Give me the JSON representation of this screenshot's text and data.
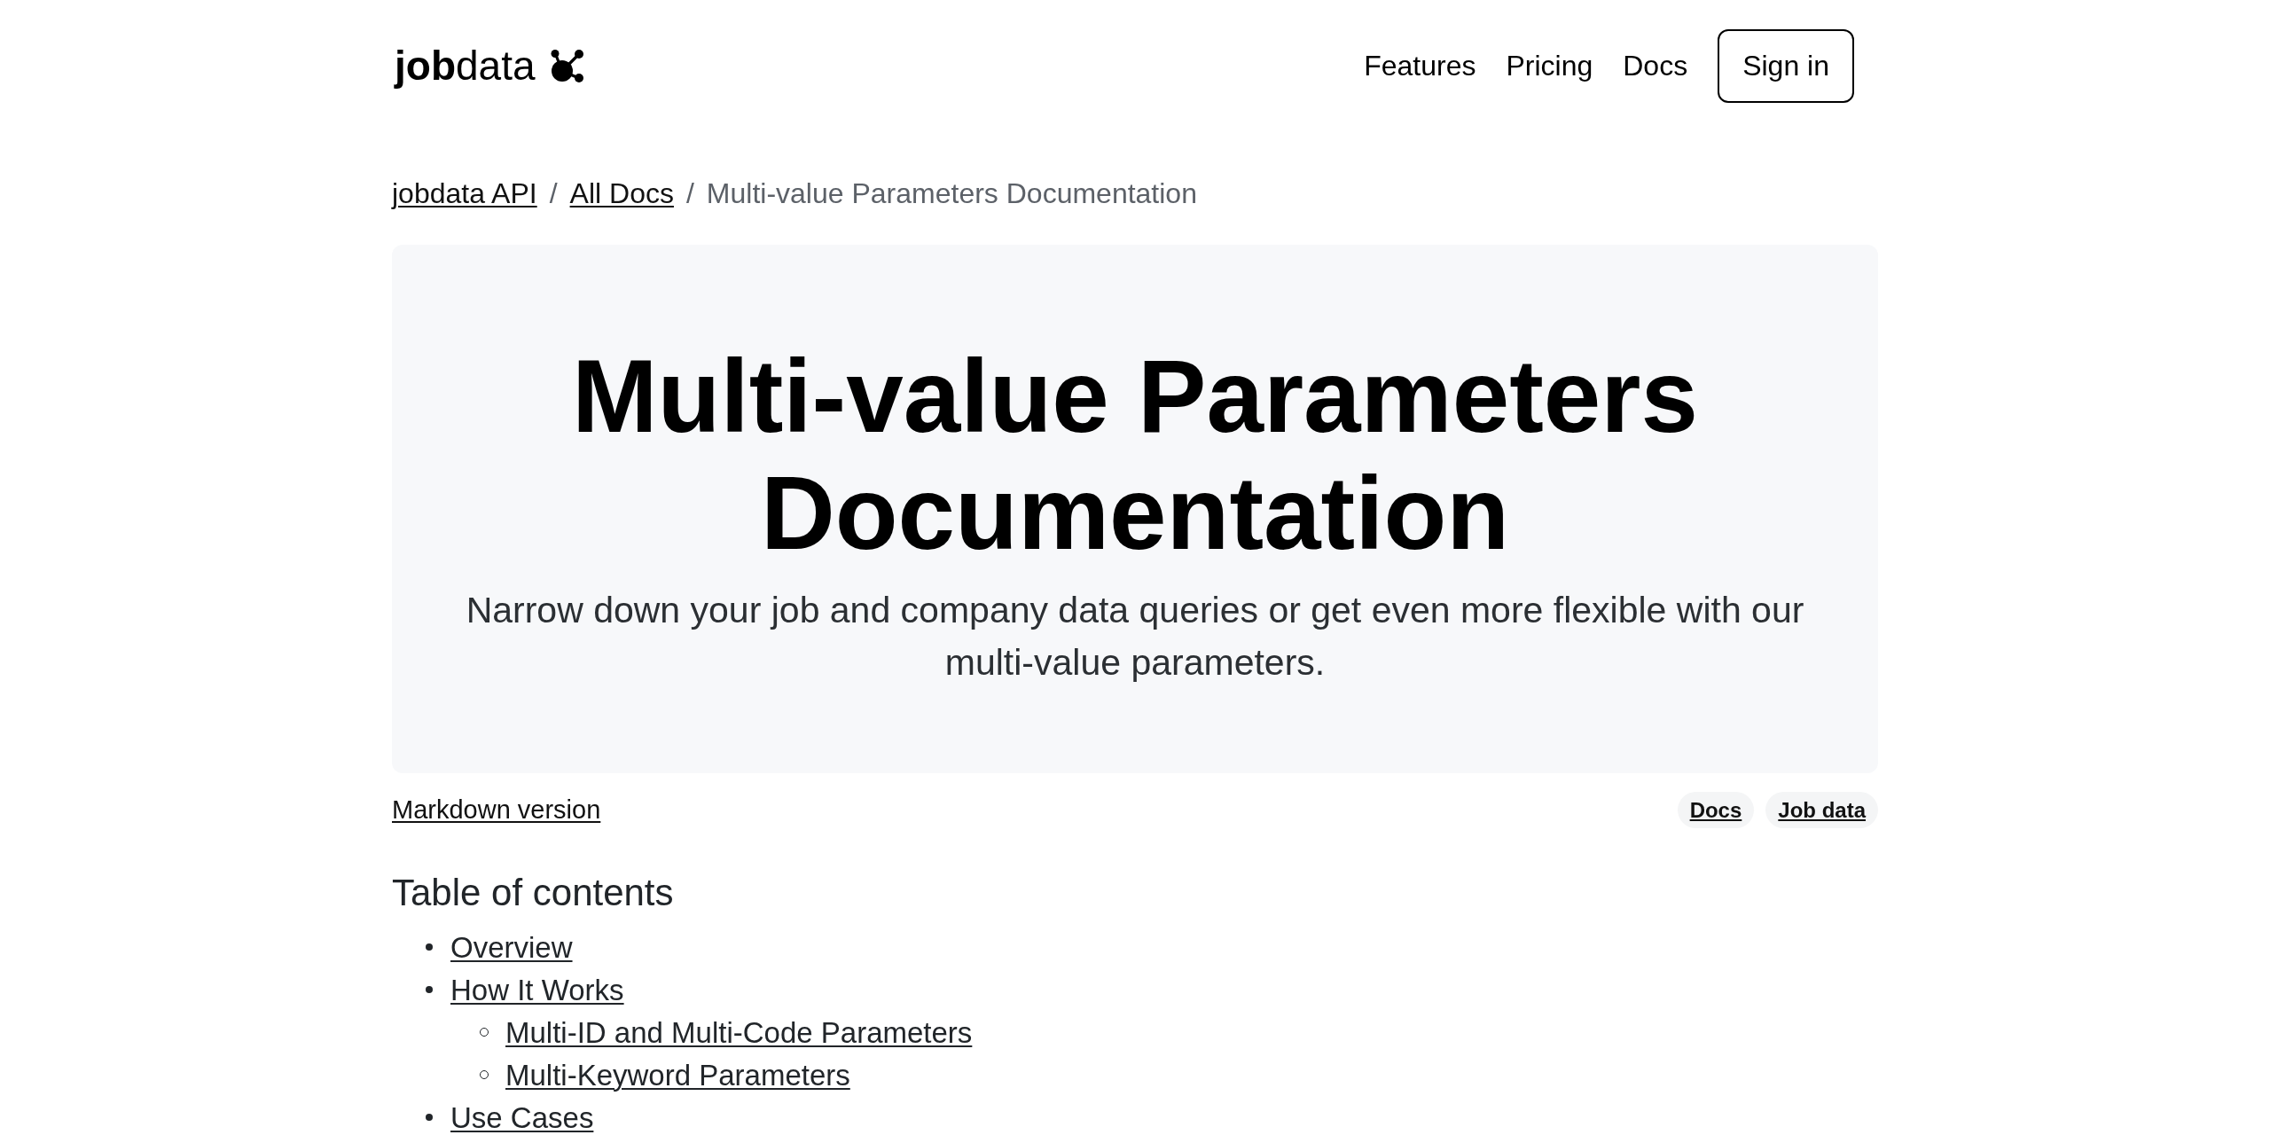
{
  "header": {
    "logo": "**job**data",
    "nav": [
      {
        "label": "Features"
      },
      {
        "label": "Pricing"
      },
      {
        "label": "Docs"
      }
    ],
    "sign_in": "Sign in"
  },
  "breadcrumb": {
    "items": [
      {
        "label": "jobdata API",
        "kind": "link"
      },
      {
        "label": "All Docs",
        "kind": "link"
      },
      {
        "label": "Multi-value Parameters Documentation",
        "kind": "current"
      }
    ],
    "separators": [
      "/",
      "/"
    ]
  },
  "hero": {
    "title": "Multi-value Parameters Documentation",
    "subtitle": "Narrow down your job and company data queries or get even more flexible with our multi-value parameters."
  },
  "meta": {
    "markdown_link": "Markdown version",
    "tags": [
      {
        "label": "Docs"
      },
      {
        "label": "Job data"
      }
    ]
  },
  "toc": {
    "title": "Table of contents",
    "items": [
      {
        "label": "Overview"
      },
      {
        "label": "How It Works",
        "children": [
          {
            "label": "Multi-ID and Multi-Code Parameters"
          },
          {
            "label": "Multi-Keyword Parameters"
          }
        ]
      },
      {
        "label": "Use Cases"
      }
    ]
  }
}
